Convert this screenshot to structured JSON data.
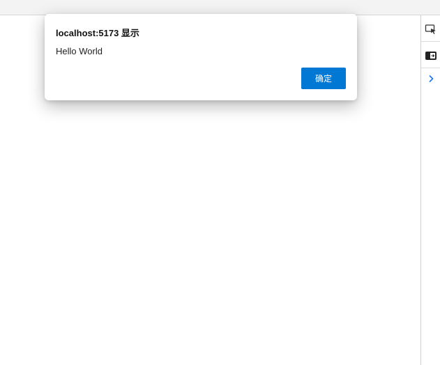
{
  "dialog": {
    "title": "localhost:5173 显示",
    "message": "Hello World",
    "ok_label": "确定"
  },
  "devtools": {
    "icons": [
      "device-toolbar-icon",
      "dock-side-icon",
      "chevron-right-icon"
    ]
  },
  "colors": {
    "accent": "#0078d4",
    "top_bar": "#f3f3f3",
    "panel_border": "#cfcfcf"
  }
}
